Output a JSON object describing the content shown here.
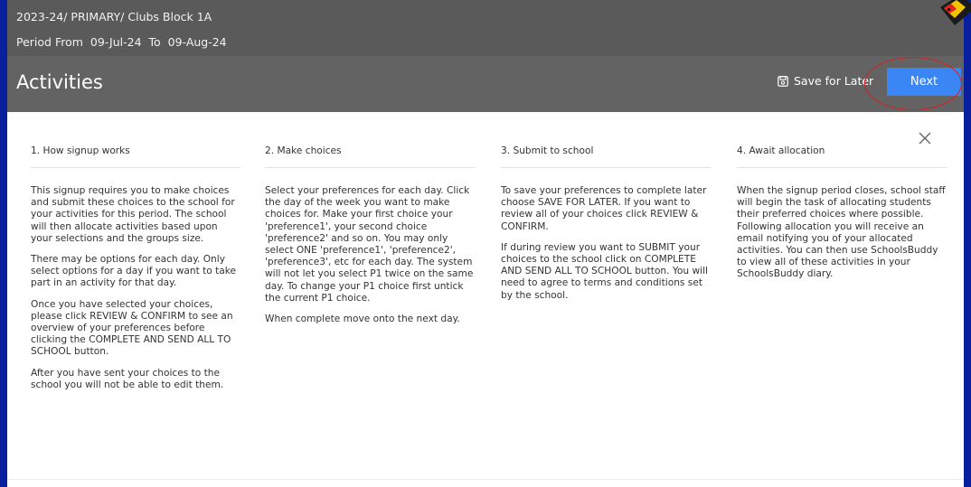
{
  "header": {
    "breadcrumb": "2023-24/ PRIMARY/ Clubs Block 1A",
    "period": {
      "from_label": "Period From",
      "from_date": "09-Jul-24",
      "to_label": "To",
      "to_date": "09-Aug-24"
    },
    "title": "Activities",
    "save_label": "Save for Later",
    "next_label": "Next"
  },
  "steps": [
    {
      "heading": "1. How signup works",
      "paragraphs": [
        "This signup requires you to make choices and submit these choices to the school for your activities for this period. The school will then allocate activities based upon your selections and the groups size.",
        "There may be options for each day. Only select options for a day if you want to take part in an activity for that day.",
        "Once you have selected your choices, please click REVIEW & CONFIRM to see an overview of your preferences before clicking the COMPLETE AND SEND ALL TO SCHOOL button.",
        "After you have sent your choices to the school you will not be able to edit them."
      ]
    },
    {
      "heading": "2. Make choices",
      "paragraphs": [
        "Select your preferences for each day. Click the day of the week you want to make choices for. Make your first choice your 'preference1', your second choice 'preference2' and so on. You may only select ONE 'preference1', 'preference2', 'preference3', etc for each day. The system will not let you select P1 twice on the same day. To change your P1 choice first untick the current P1 choice.",
        "When complete move onto the next day."
      ]
    },
    {
      "heading": "3. Submit to school",
      "paragraphs": [
        "To save your preferences to complete later choose SAVE FOR LATER. If you want to review all of your choices click REVIEW & CONFIRM.",
        "If during review you want to SUBMIT your choices to the school click on COMPLETE AND SEND ALL TO SCHOOL button. You will need to agree to terms and conditions set by the school."
      ]
    },
    {
      "heading": "4. Await allocation",
      "paragraphs": [
        "When the signup period closes, school staff will begin the task of allocating students their preferred choices where possible. Following allocation you will receive an email notifying you of your allocated activities. You can then use SchoolsBuddy to view all of these activities in your SchoolsBuddy diary."
      ]
    }
  ],
  "colors": {
    "outer_border": "#0a1f9e",
    "header_bg": "#636363",
    "next_button": "#3a86f5",
    "highlight_ring": "#e01c1c"
  },
  "icons": [
    "save-icon",
    "close-icon"
  ]
}
